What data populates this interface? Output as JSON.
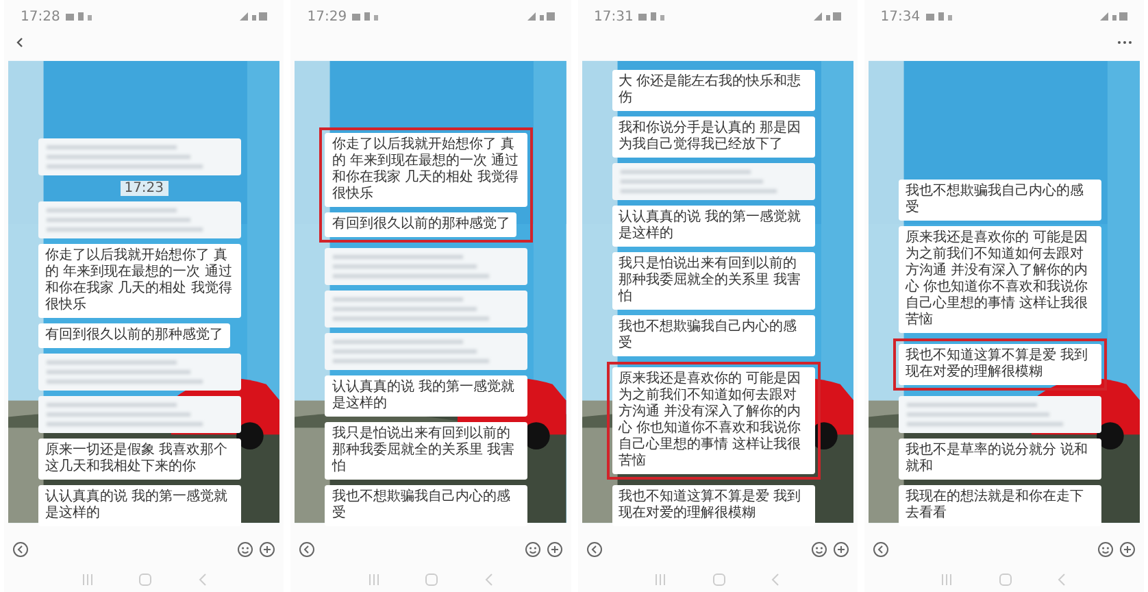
{
  "screens": [
    {
      "time": "17:28",
      "back": true,
      "more": false,
      "messages": [
        {
          "kind": "blurred",
          "highlighted": false
        },
        {
          "kind": "time",
          "text": "17:23",
          "highlighted": false
        },
        {
          "kind": "blurred",
          "highlighted": false
        },
        {
          "kind": "text",
          "text": "你走了以后我就开始想你了 真的 年来到现在最想的一次 通过和你在我家 几天的相处 我觉得很快乐",
          "highlighted": false
        },
        {
          "kind": "text",
          "text": "有回到很久以前的那种感觉了",
          "highlighted": false
        },
        {
          "kind": "blurred",
          "highlighted": false
        },
        {
          "kind": "blurred",
          "highlighted": false
        },
        {
          "kind": "text",
          "text": "原来一切还是假象 我喜欢那个这几天和我相处下来的你",
          "highlighted": false
        },
        {
          "kind": "text",
          "text": "认认真真的说 我的第一感觉就是这样的",
          "highlighted": false
        }
      ]
    },
    {
      "time": "17:29",
      "back": false,
      "more": false,
      "messages": [
        {
          "kind": "text",
          "text": "你走了以后我就开始想你了 真的 年来到现在最想的一次 通过和你在我家 几天的相处 我觉得很快乐",
          "highlighted": true
        },
        {
          "kind": "text",
          "text": "有回到很久以前的那种感觉了",
          "highlighted": true
        },
        {
          "kind": "blurred",
          "highlighted": false
        },
        {
          "kind": "blurred",
          "highlighted": false
        },
        {
          "kind": "blurred",
          "highlighted": false
        },
        {
          "kind": "text",
          "text": "认认真真的说 我的第一感觉就是这样的",
          "highlighted": false
        },
        {
          "kind": "text",
          "text": "我只是怕说出来有回到以前的那种我委屈就全的关系里 我害怕",
          "highlighted": false
        },
        {
          "kind": "text",
          "text": "我也不想欺骗我自己内心的感受",
          "highlighted": false
        }
      ]
    },
    {
      "time": "17:31",
      "back": false,
      "more": false,
      "messages": [
        {
          "kind": "text",
          "text": "大 你还是能左右我的快乐和悲伤",
          "highlighted": false
        },
        {
          "kind": "text",
          "text": "我和你说分手是认真的 那是因为我自己觉得我已经放下了",
          "highlighted": false
        },
        {
          "kind": "blurred",
          "highlighted": false
        },
        {
          "kind": "text",
          "text": "认认真真的说 我的第一感觉就是这样的",
          "highlighted": false
        },
        {
          "kind": "text",
          "text": "我只是怕说出来有回到以前的那种我委屈就全的关系里 我害怕",
          "highlighted": false
        },
        {
          "kind": "text",
          "text": "我也不想欺骗我自己内心的感受",
          "highlighted": false
        },
        {
          "kind": "text",
          "text": "原来我还是喜欢你的 可能是因为之前我们不知道如何去跟对方沟通 并没有深入了解你的内心 你也知道你不喜欢和我说你自己心里想的事情 这样让我很苦恼",
          "highlighted": true
        },
        {
          "kind": "text",
          "text": "我也不知道这算不算是爱 我到现在对爱的理解很模糊",
          "highlighted": false
        }
      ]
    },
    {
      "time": "17:34",
      "back": false,
      "more": true,
      "messages": [
        {
          "kind": "text",
          "text": "我也不想欺骗我自己内心的感受",
          "highlighted": false
        },
        {
          "kind": "text",
          "text": "原来我还是喜欢你的 可能是因为之前我们不知道如何去跟对方沟通 并没有深入了解你的内心 你也知道你不喜欢和我说你自己心里想的事情 这样让我很苦恼",
          "highlighted": false
        },
        {
          "kind": "text",
          "text": "我也不知道这算不算是爱 我到现在对爱的理解很模糊",
          "highlighted": true
        },
        {
          "kind": "blurred",
          "highlighted": false
        },
        {
          "kind": "text",
          "text": "我也不是草率的说分就分 说和就和",
          "highlighted": false
        },
        {
          "kind": "text",
          "text": "我现在的想法就是和你在走下去看看",
          "highlighted": false
        }
      ]
    }
  ]
}
